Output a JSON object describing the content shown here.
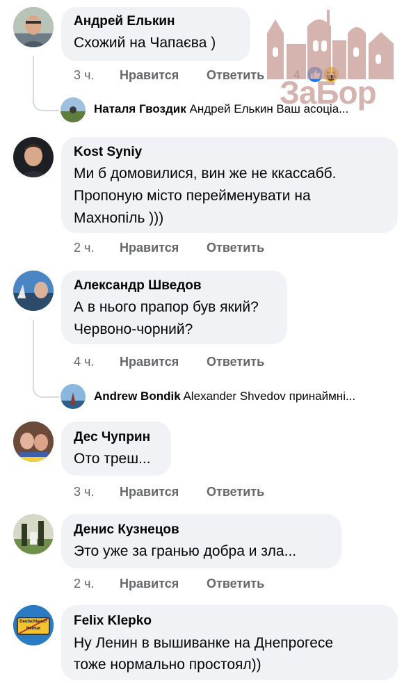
{
  "actions": {
    "like": "Нравится",
    "reply": "Ответить"
  },
  "comments": [
    {
      "author": "Андрей Елькин",
      "lines": [
        "Схожий на Чапаєва )"
      ],
      "time": "3 ч.",
      "reaction_count": "4",
      "reply": {
        "author": "Наталя Гвоздик",
        "text": "Андрей Елькин Ваш асоціа..."
      }
    },
    {
      "author": "Kost Syniy",
      "lines": [
        "Ми б домовилися, вин же не ккассабб.",
        "Пропоную місто перейменувати на",
        "Махнопіль )))"
      ],
      "time": "2 ч."
    },
    {
      "author": "Александр Шведов",
      "lines": [
        "А в нього прапор був який?",
        "Червоно-чорний?"
      ],
      "time": "4 ч.",
      "reply": {
        "author": "Andrew Bondik",
        "text": "Alexander Shvedov принаймні..."
      }
    },
    {
      "author": "Дес Чуприн",
      "lines": [
        "Ото треш..."
      ],
      "time": "3 ч."
    },
    {
      "author": "Денис Кузнецов",
      "lines": [
        "Это уже за гранью добра и зла..."
      ],
      "time": "2 ч."
    },
    {
      "author": "Felix Klepko",
      "lines": [
        "Ну Ленин в вышиванке на Днепрогесе",
        "тоже нормально простоял))"
      ],
      "avatar_sign": [
        "Deutschland?",
        "Heimat"
      ]
    }
  ],
  "watermark": {
    "text": "ЗаБор"
  },
  "colors": {
    "bubble": "#f0f2f5",
    "meta": "#65676b",
    "like_blue": "#1877f2",
    "watermark": "#c79a93"
  },
  "icons": {
    "like": "like-reaction-icon",
    "haha": "haha-reaction-icon"
  }
}
